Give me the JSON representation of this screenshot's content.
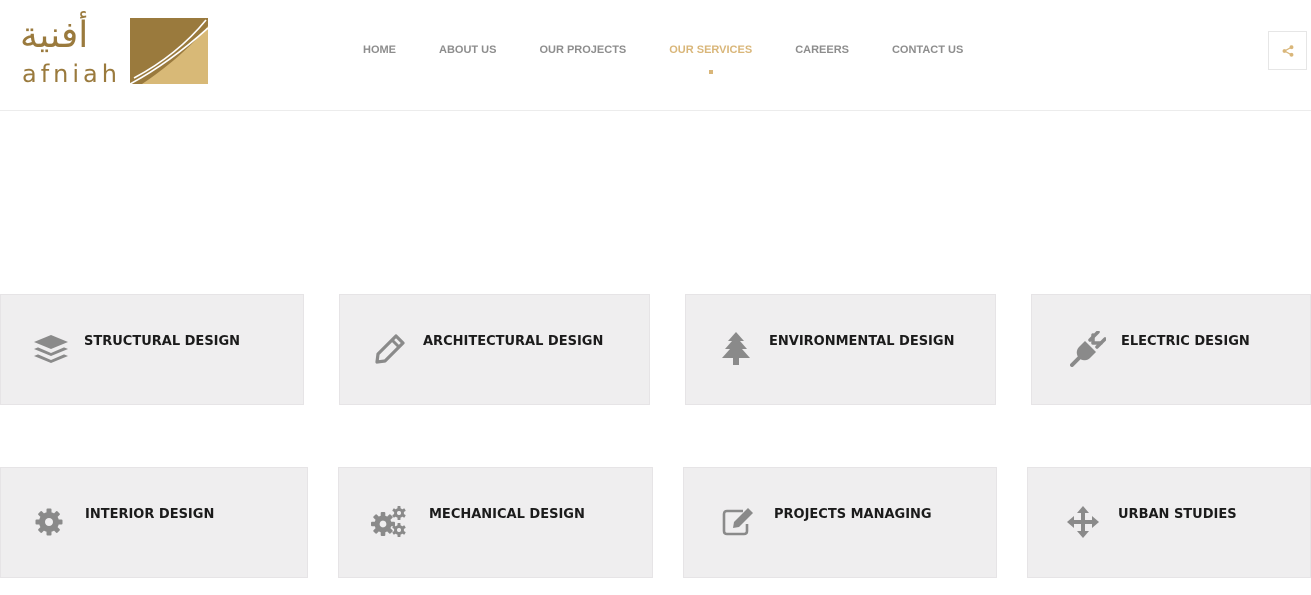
{
  "brand": {
    "logo_arabic": "أفنية",
    "logo_latin": "afniah",
    "accent_color": "#d9b679",
    "logo_color": "#9a7a3d"
  },
  "nav": {
    "items": [
      {
        "label": "HOME",
        "active": false
      },
      {
        "label": "ABOUT US",
        "active": false
      },
      {
        "label": "OUR PROJECTS",
        "active": false
      },
      {
        "label": "OUR SERVICES",
        "active": true
      },
      {
        "label": "CAREERS",
        "active": false
      },
      {
        "label": "CONTACT US",
        "active": false
      }
    ]
  },
  "share": {
    "icon": "share-icon"
  },
  "services": [
    {
      "label": "STRUCTURAL DESIGN",
      "icon": "layers-icon"
    },
    {
      "label": "ARCHITECTURAL DESIGN",
      "icon": "pencil-icon"
    },
    {
      "label": "ENVIRONMENTAL DESIGN",
      "icon": "tree-icon"
    },
    {
      "label": "ELECTRIC DESIGN",
      "icon": "plug-icon"
    },
    {
      "label": "INTERIOR DESIGN",
      "icon": "gear-icon"
    },
    {
      "label": "MECHANICAL DESIGN",
      "icon": "gears-icon"
    },
    {
      "label": "PROJECTS MANAGING",
      "icon": "edit-icon"
    },
    {
      "label": "URBAN STUDIES",
      "icon": "move-arrows-icon"
    }
  ]
}
